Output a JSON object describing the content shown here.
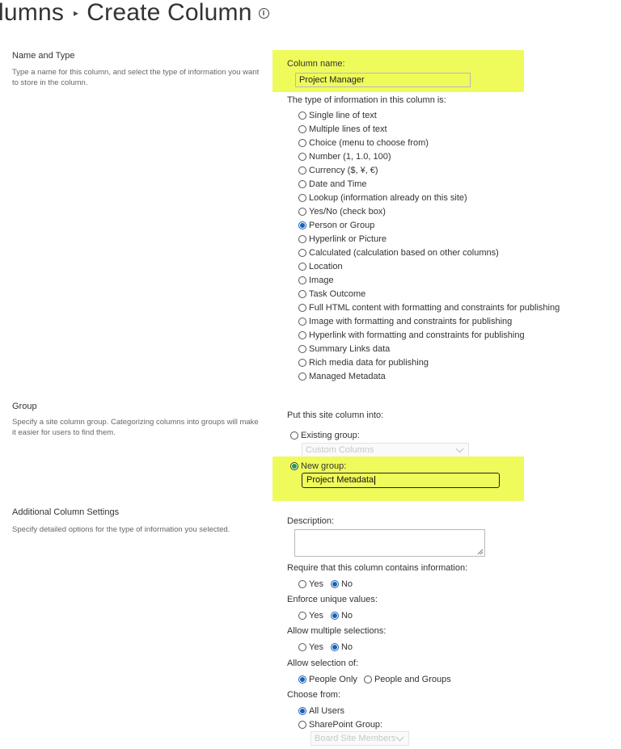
{
  "header": {
    "breadcrumb_parent": "lumns",
    "page_title": "Create Column"
  },
  "name_and_type": {
    "title": "Name and Type",
    "description": "Type a name for this column, and select the type of information you want to store in the column.",
    "column_name_label": "Column name:",
    "column_name_value": "Project Manager",
    "type_label": "The type of information in this column is:",
    "types": [
      {
        "label": "Single line of text",
        "selected": false
      },
      {
        "label": "Multiple lines of text",
        "selected": false
      },
      {
        "label": "Choice (menu to choose from)",
        "selected": false
      },
      {
        "label": "Number (1, 1.0, 100)",
        "selected": false
      },
      {
        "label": "Currency ($, ¥, €)",
        "selected": false
      },
      {
        "label": "Date and Time",
        "selected": false
      },
      {
        "label": "Lookup (information already on this site)",
        "selected": false
      },
      {
        "label": "Yes/No (check box)",
        "selected": false
      },
      {
        "label": "Person or Group",
        "selected": true
      },
      {
        "label": "Hyperlink or Picture",
        "selected": false
      },
      {
        "label": "Calculated (calculation based on other columns)",
        "selected": false
      },
      {
        "label": "Location",
        "selected": false
      },
      {
        "label": "Image",
        "selected": false
      },
      {
        "label": "Task Outcome",
        "selected": false
      },
      {
        "label": "Full HTML content with formatting and constraints for publishing",
        "selected": false
      },
      {
        "label": "Image with formatting and constraints for publishing",
        "selected": false
      },
      {
        "label": "Hyperlink with formatting and constraints for publishing",
        "selected": false
      },
      {
        "label": "Summary Links data",
        "selected": false
      },
      {
        "label": "Rich media data for publishing",
        "selected": false
      },
      {
        "label": "Managed Metadata",
        "selected": false
      }
    ]
  },
  "group": {
    "title": "Group",
    "description": "Specify a site column group. Categorizing columns into groups will make it easier for users to find them.",
    "put_into_label": "Put this site column into:",
    "existing_label": "Existing group:",
    "existing_value": "Custom Columns",
    "new_label": "New group:",
    "new_value": "Project Metadata"
  },
  "additional": {
    "title": "Additional Column Settings",
    "description": "Specify detailed options for the type of information you selected.",
    "description_label": "Description:",
    "require_label": "Require that this column contains information:",
    "unique_label": "Enforce unique values:",
    "multiple_label": "Allow multiple selections:",
    "yes": "Yes",
    "no": "No",
    "allow_selection_label": "Allow selection of:",
    "people_only": "People Only",
    "people_groups": "People and Groups",
    "choose_from_label": "Choose from:",
    "all_users": "All Users",
    "sp_group": "SharePoint Group:",
    "sp_group_value": "Board Site Members"
  },
  "colors": {
    "highlight": "#eefb5a",
    "radio_selected": "#1a5fb4",
    "radio_selected_green": "#1e9a4a"
  }
}
